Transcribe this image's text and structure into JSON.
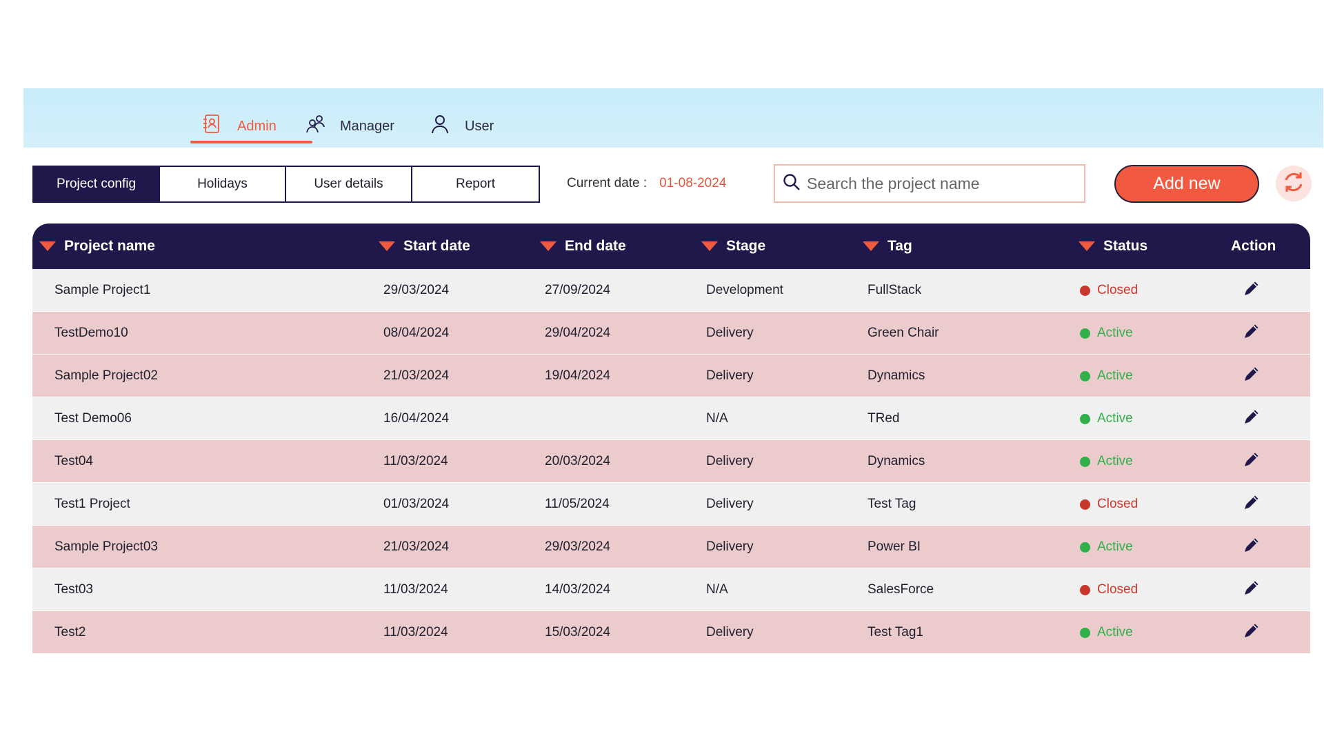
{
  "roles": [
    {
      "label": "Admin",
      "icon": "admin-badge-icon",
      "active": true
    },
    {
      "label": "Manager",
      "icon": "manager-group-icon",
      "active": false
    },
    {
      "label": "User",
      "icon": "user-icon",
      "active": false
    }
  ],
  "tabs": [
    {
      "label": "Project config",
      "active": true
    },
    {
      "label": "Holidays",
      "active": false
    },
    {
      "label": "User details",
      "active": false
    },
    {
      "label": "Report",
      "active": false
    }
  ],
  "current_date": {
    "label": "Current date :",
    "value": "01-08-2024"
  },
  "search": {
    "placeholder": "Search the project name",
    "value": ""
  },
  "add_button": {
    "label": "Add new"
  },
  "refresh": {
    "icon": "refresh-icon"
  },
  "table": {
    "columns": [
      "Project name",
      "Start date",
      "End date",
      "Stage",
      "Tag",
      "Status",
      "Action"
    ],
    "rows": [
      {
        "name": "Sample Project1",
        "start": "29/03/2024",
        "end": "27/09/2024",
        "stage": "Development",
        "tag": "FullStack",
        "status": "Closed"
      },
      {
        "name": "TestDemo10",
        "start": "08/04/2024",
        "end": "29/04/2024",
        "stage": "Delivery",
        "tag": "Green Chair",
        "status": "Active"
      },
      {
        "name": "Sample Project02",
        "start": "21/03/2024",
        "end": "19/04/2024",
        "stage": "Delivery",
        "tag": "Dynamics",
        "status": "Active"
      },
      {
        "name": "Test Demo06",
        "start": "16/04/2024",
        "end": "",
        "stage": "N/A",
        "tag": "TRed",
        "status": "Active"
      },
      {
        "name": "Test04",
        "start": "11/03/2024",
        "end": "20/03/2024",
        "stage": "Delivery",
        "tag": "Dynamics",
        "status": "Active"
      },
      {
        "name": "Test1 Project",
        "start": "01/03/2024",
        "end": "11/05/2024",
        "stage": "Delivery",
        "tag": "Test Tag",
        "status": "Closed"
      },
      {
        "name": "Sample Project03",
        "start": "21/03/2024",
        "end": "29/03/2024",
        "stage": "Delivery",
        "tag": "Power BI",
        "status": "Active"
      },
      {
        "name": "Test03",
        "start": "11/03/2024",
        "end": "14/03/2024",
        "stage": "N/A",
        "tag": "SalesForce",
        "status": "Closed"
      },
      {
        "name": "Test2",
        "start": "11/03/2024",
        "end": "15/03/2024",
        "stage": "Delivery",
        "tag": "Test Tag1",
        "status": "Active"
      }
    ]
  },
  "colors": {
    "header_bg": "#20184a",
    "accent": "#f05a3e",
    "row_pink": "#ebcbcb",
    "row_gray": "#f0f0f0",
    "status_active": "#2fb04a",
    "status_closed": "#d0372a",
    "role_bar": "#c8ecfa"
  }
}
